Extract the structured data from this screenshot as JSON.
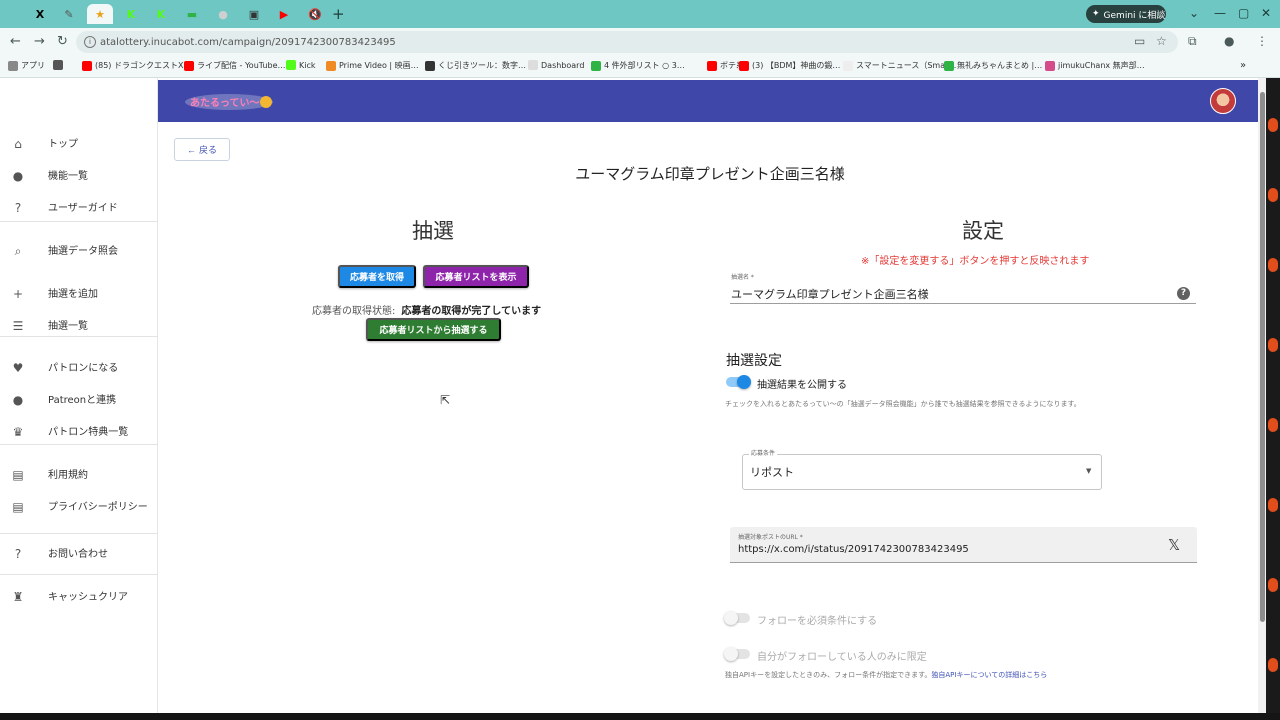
{
  "browser": {
    "tabs": [
      {
        "icon": "X",
        "color": "#000000"
      },
      {
        "icon": "✎",
        "color": "#555555"
      },
      {
        "icon": "★",
        "color": "#e8a21a"
      },
      {
        "icon": "K",
        "color": "#53fc18"
      },
      {
        "icon": "K",
        "color": "#53fc18"
      },
      {
        "icon": "▬",
        "color": "#2fb344"
      },
      {
        "icon": "●",
        "color": "#cfcfcf"
      },
      {
        "icon": "▣",
        "color": "#333333"
      },
      {
        "icon": "▶",
        "color": "#ff0000"
      },
      {
        "icon": "🔇",
        "color": "#333333"
      }
    ],
    "new_tab": "+",
    "gemini_label": "Gemini に相談",
    "window_controls": [
      "⌄",
      "—",
      "▢",
      "✕"
    ],
    "url": "atalottery.inucabot.com/campaign/2091742300783423495",
    "bookmarks": [
      {
        "label": "アプリ",
        "color": "#888888"
      },
      {
        "label": "",
        "color": "#555555"
      },
      {
        "label": "(85) ドラゴンクエストX…",
        "color": "#ff0000"
      },
      {
        "label": "ライブ配信 - YouTube…",
        "color": "#ff0000"
      },
      {
        "label": "Kick",
        "color": "#53fc18"
      },
      {
        "label": "Prime Video | 映画…",
        "color": "#f08a24"
      },
      {
        "label": "くじ引きツール：数字…",
        "color": "#333333"
      },
      {
        "label": "Dashboard",
        "color": "#dddddd"
      },
      {
        "label": "4 件外部リスト ○ 3…",
        "color": "#2fb344"
      },
      {
        "label": "ボテ系",
        "color": "#ff0000"
      },
      {
        "label": "(3) 【BDM】神曲の鍛…",
        "color": "#ff0000"
      },
      {
        "label": "スマートニュース（Smar…",
        "color": "#eeeeee"
      },
      {
        "label": "無礼みちゃんまとめ |…",
        "color": "#2fb344"
      },
      {
        "label": "jimukuChanx 無声部…",
        "color": "#d44d8a"
      }
    ]
  },
  "sidebar": {
    "items": [
      {
        "label": "トップ",
        "icon": "home-icon",
        "glyph": "⌂"
      },
      {
        "label": "機能一覧",
        "icon": "info-icon",
        "glyph": "●"
      },
      {
        "label": "ユーザーガイド",
        "icon": "help-icon",
        "glyph": "?"
      },
      {
        "label": "抽選データ照会",
        "icon": "search-icon",
        "glyph": "⌕"
      },
      {
        "label": "抽選を追加",
        "icon": "plus-icon",
        "glyph": "+"
      },
      {
        "label": "抽選一覧",
        "icon": "list-icon",
        "glyph": "☰"
      },
      {
        "label": "パトロンになる",
        "icon": "patron-icon",
        "glyph": "♥"
      },
      {
        "label": "Patreonと連携",
        "icon": "patreon-icon",
        "glyph": "●"
      },
      {
        "label": "パトロン特典一覧",
        "icon": "trophy-icon",
        "glyph": "♛"
      },
      {
        "label": "利用規約",
        "icon": "document-icon",
        "glyph": "▤"
      },
      {
        "label": "プライバシーポリシー",
        "icon": "document-icon",
        "glyph": "▤"
      },
      {
        "label": "お問い合わせ",
        "icon": "help-icon",
        "glyph": "?"
      },
      {
        "label": "キャッシュクリア",
        "icon": "broom-icon",
        "glyph": "♜"
      }
    ]
  },
  "header": {
    "logo_text": "あたるってい〜"
  },
  "main": {
    "back_label": "戻る",
    "title": "ユーマグラム印章プレゼント企画三名様",
    "lottery": {
      "heading": "抽選",
      "fetch_button": "応募者を取得",
      "show_list_button": "応募者リストを表示",
      "status_key": "応募者の取得状態:",
      "status_value": "応募者の取得が完了しています",
      "draw_button": "応募者リストから抽選する"
    },
    "settings": {
      "heading": "設定",
      "warning": "※「設定を変更する」ボタンを押すと反映されます",
      "name_label": "抽選名 *",
      "name_value": "ユーマグラム印章プレゼント企画三名様",
      "section_title": "抽選設定",
      "publish_label": "抽選結果を公開する",
      "publish_on": true,
      "publish_hint": "チェックを入れるとあたるってい〜の「抽選データ照会機能」から誰でも抽選結果を参照できるようになります。",
      "condition_label": "応募条件",
      "condition_value": "リポスト",
      "url_label": "抽選対象ポストのURL *",
      "url_value": "https://x.com/i/status/2091742300783423495",
      "follow_required_label": "フォローを必須条件にする",
      "follow_only_label": "自分がフォローしている人のみに限定",
      "api_hint": "独自APIキーを設定したときのみ、フォロー条件が指定できます。",
      "api_link": "独自APIキーについての詳細はこちら"
    }
  },
  "colors": {
    "header": "#3f48a9",
    "fetch_button": "#1e88e5",
    "show_list_button": "#8e24aa",
    "draw_button": "#2e7d32",
    "warning": "#e53935",
    "toggle_on": "#1e88e5"
  }
}
